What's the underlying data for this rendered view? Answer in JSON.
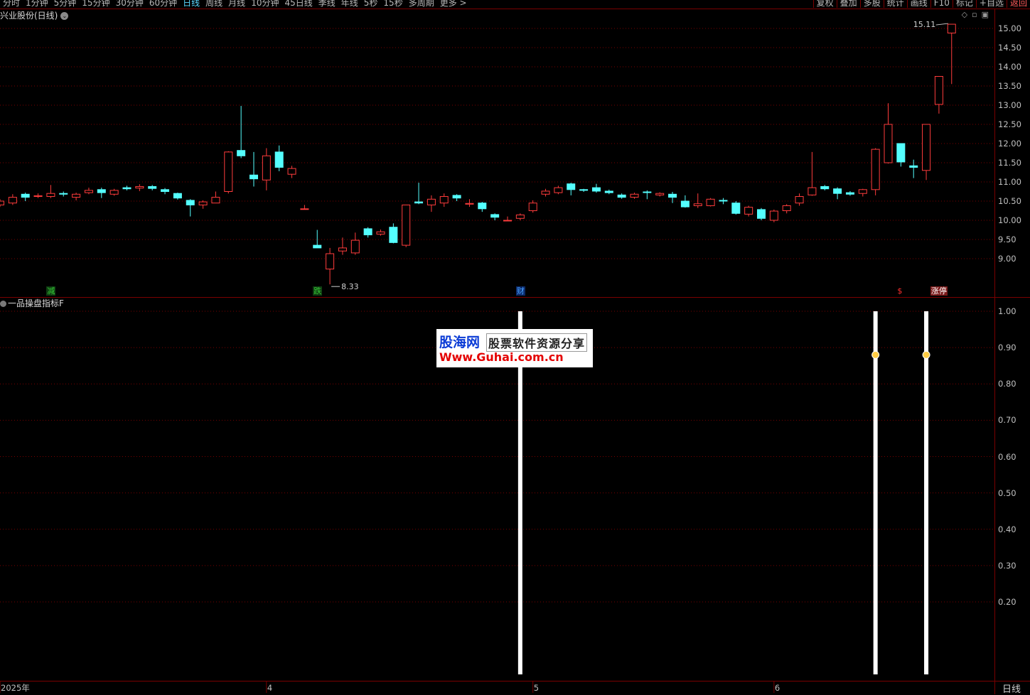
{
  "toolbar": {
    "periods": [
      "分时",
      "1分钟",
      "5分钟",
      "15分钟",
      "30分钟",
      "60分钟",
      "日线",
      "周线",
      "月线",
      "10分钟",
      "45日线",
      "季线",
      "年线",
      "5秒",
      "15秒",
      "多周期",
      "更多 >"
    ],
    "active_period": "日线",
    "tools": [
      "复权",
      "叠加",
      "多股",
      "统计",
      "画线",
      "F10",
      "标记",
      "+自选",
      "返回"
    ]
  },
  "main_chart": {
    "title": "兴业股份(日线)",
    "y_ticks": [
      "15.00",
      "14.50",
      "14.00",
      "13.50",
      "13.00",
      "12.50",
      "12.00",
      "11.50",
      "11.00",
      "10.50",
      "10.00",
      "9.50",
      "9.00"
    ],
    "high_label": "15.11",
    "low_label": "8.33",
    "markers": [
      {
        "text": "减",
        "color": "#35c635"
      },
      {
        "text": "跌",
        "color": "#35c635"
      },
      {
        "text": "财",
        "color": "#4aa3ff"
      },
      {
        "text": "$",
        "color": "#ff3030"
      },
      {
        "text": "涨停",
        "color": "#ffffff"
      }
    ]
  },
  "indicator_chart": {
    "title": "一品操盘指标F",
    "y_ticks": [
      "1.00",
      "0.90",
      "0.80",
      "0.70",
      "0.60",
      "0.50",
      "0.40",
      "0.30",
      "0.20"
    ]
  },
  "x_axis": {
    "labels": [
      "2025年",
      "4",
      "5",
      "6"
    ],
    "period_label": "日线"
  },
  "watermark": {
    "brand": "股海网",
    "tagline": "股票软件资源分享",
    "url": "Www.Guhai.com.cn"
  },
  "colors": {
    "up": "#ff3c3c",
    "down": "#54ffff",
    "grid": "#7a0000",
    "bar": "#ffffff",
    "dot": "#ffcc44"
  },
  "chart_data": [
    {
      "type": "candlestick",
      "title": "兴业股份(日线)",
      "ylim": [
        8.3,
        15.2
      ],
      "grid": true,
      "candles": [
        {
          "o": 10.4,
          "c": 10.5,
          "h": 10.55,
          "l": 10.35
        },
        {
          "o": 10.45,
          "c": 10.6,
          "h": 10.68,
          "l": 10.4
        },
        {
          "o": 10.68,
          "c": 10.6,
          "h": 10.72,
          "l": 10.5
        },
        {
          "o": 10.62,
          "c": 10.64,
          "h": 10.7,
          "l": 10.58
        },
        {
          "o": 10.62,
          "c": 10.7,
          "h": 10.92,
          "l": 10.58
        },
        {
          "o": 10.7,
          "c": 10.68,
          "h": 10.75,
          "l": 10.62
        },
        {
          "o": 10.6,
          "c": 10.68,
          "h": 10.72,
          "l": 10.52
        },
        {
          "o": 10.72,
          "c": 10.78,
          "h": 10.85,
          "l": 10.68
        },
        {
          "o": 10.8,
          "c": 10.72,
          "h": 10.85,
          "l": 10.58
        },
        {
          "o": 10.68,
          "c": 10.78,
          "h": 10.82,
          "l": 10.64
        },
        {
          "o": 10.85,
          "c": 10.82,
          "h": 10.9,
          "l": 10.78
        },
        {
          "o": 10.84,
          "c": 10.88,
          "h": 10.94,
          "l": 10.76
        },
        {
          "o": 10.88,
          "c": 10.83,
          "h": 10.92,
          "l": 10.78
        },
        {
          "o": 10.8,
          "c": 10.75,
          "h": 10.84,
          "l": 10.68
        },
        {
          "o": 10.7,
          "c": 10.58,
          "h": 10.72,
          "l": 10.54
        },
        {
          "o": 10.52,
          "c": 10.4,
          "h": 10.55,
          "l": 10.1
        },
        {
          "o": 10.4,
          "c": 10.48,
          "h": 10.52,
          "l": 10.3
        },
        {
          "o": 10.45,
          "c": 10.6,
          "h": 10.75,
          "l": 10.45
        },
        {
          "o": 10.75,
          "c": 11.78,
          "h": 11.8,
          "l": 10.7
        },
        {
          "o": 11.82,
          "c": 11.68,
          "h": 12.98,
          "l": 11.62
        },
        {
          "o": 11.18,
          "c": 11.08,
          "h": 11.78,
          "l": 10.88
        },
        {
          "o": 11.05,
          "c": 11.68,
          "h": 11.88,
          "l": 10.78
        },
        {
          "o": 11.78,
          "c": 11.38,
          "h": 11.95,
          "l": 11.28
        },
        {
          "o": 11.2,
          "c": 11.35,
          "h": 11.42,
          "l": 11.1
        },
        {
          "o": 10.3,
          "c": 10.3,
          "h": 10.4,
          "l": 10.3
        },
        {
          "o": 9.35,
          "c": 9.28,
          "h": 9.75,
          "l": 9.28
        },
        {
          "o": 8.73,
          "c": 9.13,
          "h": 9.28,
          "l": 8.33
        },
        {
          "o": 9.2,
          "c": 9.28,
          "h": 9.55,
          "l": 9.1
        },
        {
          "o": 9.15,
          "c": 9.48,
          "h": 9.68,
          "l": 9.1
        },
        {
          "o": 9.78,
          "c": 9.62,
          "h": 9.82,
          "l": 9.55
        },
        {
          "o": 9.64,
          "c": 9.7,
          "h": 9.76,
          "l": 9.6
        },
        {
          "o": 9.82,
          "c": 9.42,
          "h": 9.92,
          "l": 9.4
        },
        {
          "o": 9.35,
          "c": 10.4,
          "h": 10.4,
          "l": 9.3
        },
        {
          "o": 10.48,
          "c": 10.45,
          "h": 10.98,
          "l": 10.42
        },
        {
          "o": 10.4,
          "c": 10.55,
          "h": 10.65,
          "l": 10.22
        },
        {
          "o": 10.45,
          "c": 10.62,
          "h": 10.7,
          "l": 10.35
        },
        {
          "o": 10.65,
          "c": 10.58,
          "h": 10.68,
          "l": 10.5
        },
        {
          "o": 10.42,
          "c": 10.44,
          "h": 10.55,
          "l": 10.35
        },
        {
          "o": 10.45,
          "c": 10.3,
          "h": 10.48,
          "l": 10.22
        },
        {
          "o": 10.15,
          "c": 10.08,
          "h": 10.18,
          "l": 10.0
        },
        {
          "o": 10.0,
          "c": 10.0,
          "h": 10.1,
          "l": 9.98
        },
        {
          "o": 10.05,
          "c": 10.14,
          "h": 10.18,
          "l": 10.0
        },
        {
          "o": 10.25,
          "c": 10.45,
          "h": 10.52,
          "l": 10.2
        },
        {
          "o": 10.68,
          "c": 10.76,
          "h": 10.82,
          "l": 10.62
        },
        {
          "o": 10.72,
          "c": 10.85,
          "h": 10.9,
          "l": 10.68
        },
        {
          "o": 10.95,
          "c": 10.8,
          "h": 10.98,
          "l": 10.65
        },
        {
          "o": 10.8,
          "c": 10.78,
          "h": 10.82,
          "l": 10.74
        },
        {
          "o": 10.85,
          "c": 10.76,
          "h": 10.95,
          "l": 10.72
        },
        {
          "o": 10.76,
          "c": 10.72,
          "h": 10.8,
          "l": 10.68
        },
        {
          "o": 10.66,
          "c": 10.6,
          "h": 10.7,
          "l": 10.56
        },
        {
          "o": 10.6,
          "c": 10.68,
          "h": 10.72,
          "l": 10.56
        },
        {
          "o": 10.74,
          "c": 10.73,
          "h": 10.78,
          "l": 10.55
        },
        {
          "o": 10.66,
          "c": 10.7,
          "h": 10.73,
          "l": 10.62
        },
        {
          "o": 10.68,
          "c": 10.6,
          "h": 10.74,
          "l": 10.45
        },
        {
          "o": 10.5,
          "c": 10.35,
          "h": 10.65,
          "l": 10.33
        },
        {
          "o": 10.38,
          "c": 10.43,
          "h": 10.7,
          "l": 10.32
        },
        {
          "o": 10.38,
          "c": 10.55,
          "h": 10.58,
          "l": 10.36
        },
        {
          "o": 10.52,
          "c": 10.5,
          "h": 10.58,
          "l": 10.42
        },
        {
          "o": 10.45,
          "c": 10.18,
          "h": 10.5,
          "l": 10.15
        },
        {
          "o": 10.16,
          "c": 10.34,
          "h": 10.38,
          "l": 10.1
        },
        {
          "o": 10.28,
          "c": 10.05,
          "h": 10.32,
          "l": 10.0
        },
        {
          "o": 10.0,
          "c": 10.24,
          "h": 10.28,
          "l": 9.95
        },
        {
          "o": 10.25,
          "c": 10.38,
          "h": 10.42,
          "l": 10.18
        },
        {
          "o": 10.45,
          "c": 10.62,
          "h": 10.7,
          "l": 10.38
        },
        {
          "o": 10.66,
          "c": 10.85,
          "h": 11.78,
          "l": 10.64
        },
        {
          "o": 10.88,
          "c": 10.82,
          "h": 10.92,
          "l": 10.78
        },
        {
          "o": 10.82,
          "c": 10.7,
          "h": 10.86,
          "l": 10.55
        },
        {
          "o": 10.72,
          "c": 10.68,
          "h": 10.76,
          "l": 10.64
        },
        {
          "o": 10.7,
          "c": 10.8,
          "h": 10.82,
          "l": 10.62
        },
        {
          "o": 10.8,
          "c": 11.85,
          "h": 11.88,
          "l": 10.65
        },
        {
          "o": 11.5,
          "c": 12.5,
          "h": 13.05,
          "l": 11.48
        },
        {
          "o": 12.0,
          "c": 11.52,
          "h": 12.0,
          "l": 11.4
        },
        {
          "o": 11.42,
          "c": 11.38,
          "h": 11.58,
          "l": 11.1
        },
        {
          "o": 11.3,
          "c": 12.5,
          "h": 12.5,
          "l": 11.05
        },
        {
          "o": 13.02,
          "c": 13.75,
          "h": 13.75,
          "l": 12.78
        },
        {
          "o": 14.88,
          "c": 15.11,
          "h": 15.11,
          "l": 13.55
        }
      ]
    },
    {
      "type": "bar",
      "title": "一品操盘指标F",
      "ylim": [
        0.0,
        1.03
      ],
      "grid": true,
      "values_at_candle_index": [
        {
          "index": 41,
          "value": 1.0
        },
        {
          "index": 69,
          "value": 1.0
        },
        {
          "index": 73,
          "value": 1.0
        }
      ],
      "dots_at_candle_index": [
        {
          "index": 69,
          "value": 0.88
        },
        {
          "index": 73,
          "value": 0.88
        }
      ]
    }
  ]
}
